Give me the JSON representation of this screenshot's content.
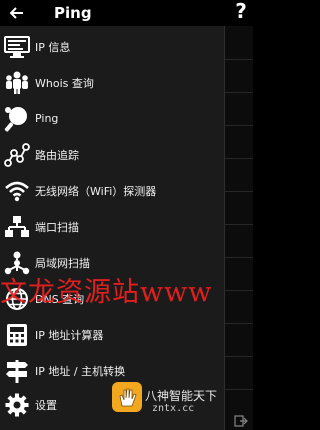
{
  "appbar": {
    "title": "Ping",
    "back_icon": "arrow-left-icon",
    "help_label": "?"
  },
  "drawer": {
    "items": [
      {
        "label": "IP 信息",
        "icon": "monitor-icon"
      },
      {
        "label": "Whois 查询",
        "icon": "people-icon"
      },
      {
        "label": "Ping",
        "icon": "ping-pong-icon"
      },
      {
        "label": "路由追踪",
        "icon": "route-icon"
      },
      {
        "label": "无线网络（WiFi）探测器",
        "icon": "wifi-icon"
      },
      {
        "label": "端口扫描",
        "icon": "network-tree-icon"
      },
      {
        "label": "局域网扫描",
        "icon": "lan-icon"
      },
      {
        "label": "DNS 查询",
        "icon": "globe-icon"
      },
      {
        "label": "IP 地址计算器",
        "icon": "calculator-icon"
      },
      {
        "label": "IP 地址 / 主机转换",
        "icon": "signpost-icon"
      },
      {
        "label": "设置",
        "icon": "gear-icon"
      }
    ]
  },
  "watermark": {
    "text": "文龙资源站www",
    "badge_name": "八神智能天下",
    "badge_url": "zntx.cc",
    "color": "#f12020"
  },
  "colors": {
    "drawer_bg": "#1b1b1b",
    "appbar_bg": "#000000",
    "text": "#f0f0f0"
  }
}
